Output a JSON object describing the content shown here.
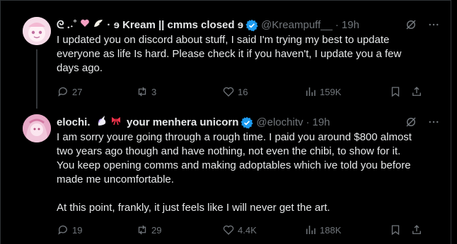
{
  "tweets": [
    {
      "display_name": "Kream || cmms closed",
      "name_prefix": "ᘓ .˖˚",
      "name_suffix": "ɘ",
      "handle": "@Kreampuff__",
      "time": "19h",
      "lines": [
        "I updated you on discord about stuff, I said I'm trying my best to update",
        "everyone as life Is hard. Please check it if you haven't, I update you a few",
        "days ago."
      ],
      "replies": "27",
      "reposts": "3",
      "likes": "16",
      "views": "159K",
      "avatar_bg": "#f3d4e3"
    },
    {
      "display_name": "elochi.",
      "name_suffix_text": "your menhera unicorn",
      "handle": "@elochitv",
      "time": "19h",
      "lines": [
        "I am sorry youre going through a rough time. I paid you around $800 almost",
        "two years ago though and have nothing, not even the chibi, to show for it.",
        "You keep opening comms and making adoptables which ive told you before",
        "made me uncomfortable."
      ],
      "line_final": "At this point, frankly, it just feels like I will never get the art.",
      "replies": "19",
      "reposts": "29",
      "likes": "4.4K",
      "views": "188K",
      "avatar_bg": "#e8a6c4"
    }
  ],
  "colors": {
    "accent": "#1d9bf0",
    "muted": "#71767b",
    "text": "#e7e9ea",
    "border": "#2f3336"
  }
}
